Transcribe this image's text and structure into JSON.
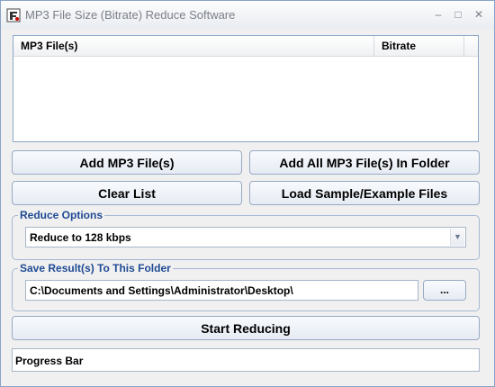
{
  "window": {
    "title": "MP3 File Size (Bitrate) Reduce Software"
  },
  "titlebar": {
    "icon": "app-icon",
    "controls": [
      {
        "name": "minimize-button",
        "glyph": "–"
      },
      {
        "name": "maximize-button",
        "glyph": "□"
      },
      {
        "name": "close-button",
        "glyph": "✕"
      }
    ]
  },
  "file_list": {
    "columns": [
      {
        "label": "MP3 File(s)"
      },
      {
        "label": "Bitrate"
      }
    ],
    "rows": []
  },
  "buttons": {
    "add_files": "Add MP3 File(s)",
    "add_folder": "Add All MP3 File(s) In Folder",
    "clear_list": "Clear List",
    "load_samples": "Load Sample/Example Files",
    "browse": "...",
    "start": "Start Reducing"
  },
  "reduce_options": {
    "label": "Reduce Options",
    "selected": "Reduce to 128 kbps"
  },
  "save_folder": {
    "label": "Save Result(s) To This Folder",
    "value": "C:\\Documents and Settings\\Administrator\\Desktop\\"
  },
  "progress": {
    "label": "Progress Bar"
  }
}
